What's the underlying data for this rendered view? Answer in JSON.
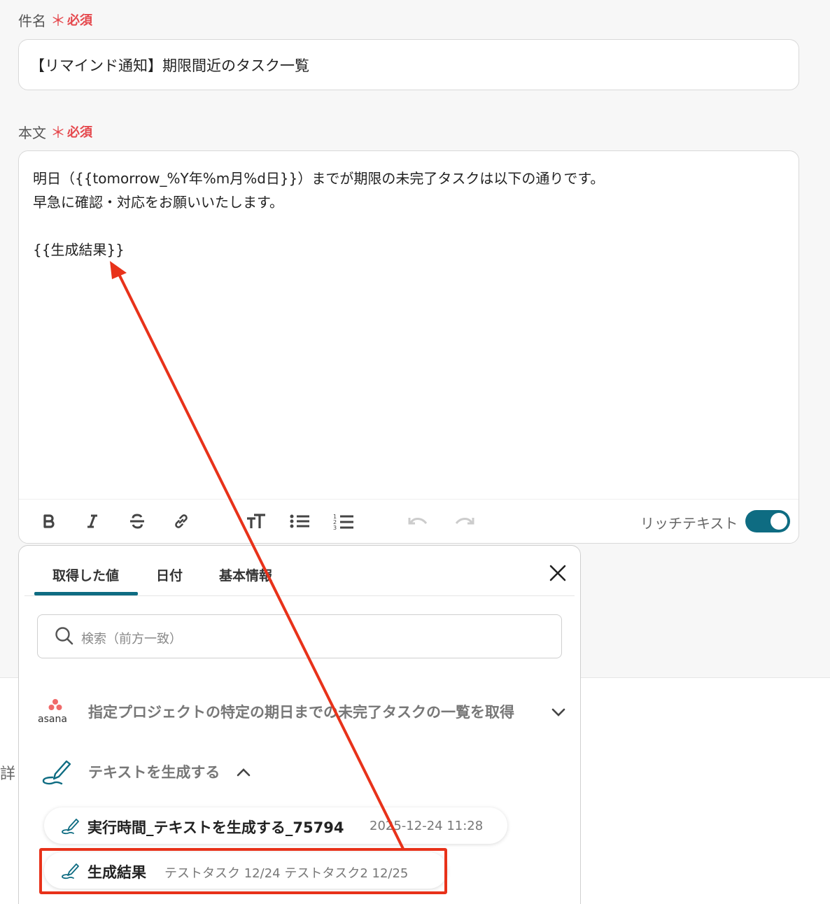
{
  "subject": {
    "label": "件名",
    "required_star": "＊",
    "required_text": "必須",
    "value": "【リマインド通知】期限間近のタスク一覧"
  },
  "body": {
    "label": "本文",
    "required_star": "＊",
    "required_text": "必須",
    "lines": [
      "明日（{{tomorrow_%Y年%m月%d日}}）までが期限の未完了タスクは以下の通りです。",
      "早急に確認・対応をお願いいたします。",
      "",
      "{{生成結果}}"
    ]
  },
  "toolbar": {
    "rich_text_label": "リッチテキスト",
    "rich_text_enabled": true,
    "buttons": [
      "bold-icon",
      "italic-icon",
      "strikethrough-icon",
      "link-icon",
      "text-size-icon",
      "bullet-list-icon",
      "numbered-list-icon",
      "undo-icon",
      "redo-icon"
    ]
  },
  "side_text": "詳",
  "popup": {
    "tabs": [
      "取得した値",
      "日付",
      "基本情報"
    ],
    "active_tab": "取得した値",
    "search_placeholder": "検索（前方一致）",
    "groups": [
      {
        "app": "asana",
        "title": "指定プロジェクトの特定の期日までの未完了タスクの一覧を取得",
        "expanded": false
      },
      {
        "app": "pencil-icon",
        "title": "テキストを生成する",
        "expanded": true,
        "items": [
          {
            "title": "実行時間_テキストを生成する_75794",
            "value": "2025-12-24 11:28"
          },
          {
            "title": "生成結果",
            "value": "テストタスク 12/24 テストタスク2 12/25"
          }
        ]
      }
    ]
  },
  "colors": {
    "accent": "#0e6c82",
    "required": "#e5484d",
    "annotation": "#e8321a"
  }
}
